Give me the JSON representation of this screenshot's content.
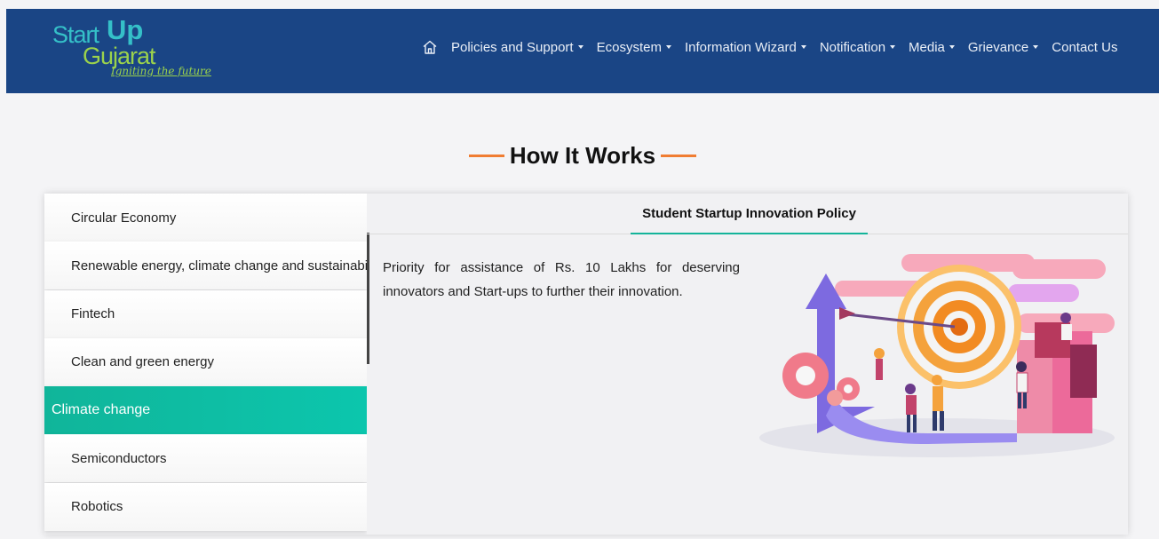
{
  "header": {
    "logo": {
      "line1": "Start",
      "line2": "Up",
      "line3": "Gujarat",
      "tagline": "Igniting the future"
    },
    "home_icon": "home-icon",
    "menu": [
      {
        "label": "Policies and Support",
        "dropdown": true
      },
      {
        "label": "Ecosystem",
        "dropdown": true
      },
      {
        "label": "Information Wizard",
        "dropdown": true
      },
      {
        "label": "Notification",
        "dropdown": true
      },
      {
        "label": "Media",
        "dropdown": true
      },
      {
        "label": "Grievance",
        "dropdown": true
      },
      {
        "label": "Contact Us",
        "dropdown": false
      }
    ],
    "colors": {
      "background": "#1a4585",
      "logo_blue": "#35c0c8",
      "logo_green": "#9bd24c"
    }
  },
  "section": {
    "title": "How It Works",
    "accent_color": "#f07d32"
  },
  "sidebar": {
    "items": [
      {
        "label": "Circular Economy",
        "active": false
      },
      {
        "label": "Renewable energy, climate change and sustainability",
        "active": false
      },
      {
        "label": "Fintech",
        "active": false
      },
      {
        "label": "Clean and green energy",
        "active": false
      },
      {
        "label": "Climate change",
        "active": true
      },
      {
        "label": "Semiconductors",
        "active": false
      },
      {
        "label": "Robotics",
        "active": false
      }
    ],
    "active_color": "#0cc6ad"
  },
  "content": {
    "tab_label": "Student Startup Innovation Policy",
    "description": "Priority for assistance of Rs. 10 Lakhs for deserving innovators and Start-ups to further their innovation.",
    "illustration": "target-growth-illustration"
  }
}
